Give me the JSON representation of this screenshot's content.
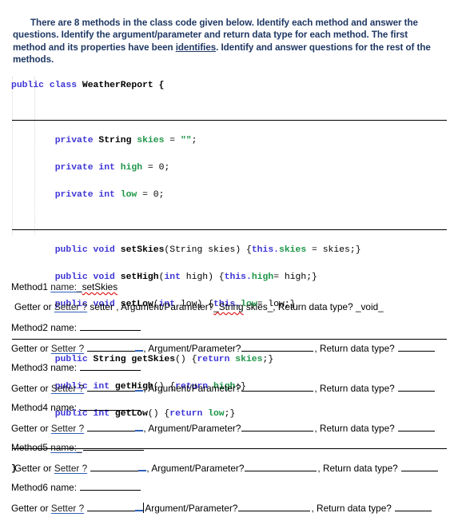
{
  "document": {
    "intro": {
      "part1": "There are 8 methods in the class code given below. Identify each method and answer the questions. Identify the argument/parameter and return data type for each method. The first method and its properties have been ",
      "underlined_word": "identifies",
      "part2": ". Identify and answer questions for the rest of the methods."
    },
    "code": {
      "language": "java",
      "class_name": "WeatherReport",
      "lines": [
        {
          "id": "line-class-decl",
          "text": "public class WeatherReport {"
        },
        {
          "id": "line-blank-1",
          "text": ""
        },
        {
          "id": "line-field-skies",
          "text": "        private String skies = \"\";"
        },
        {
          "id": "line-field-high",
          "text": "        private int high = 0;"
        },
        {
          "id": "line-field-low",
          "text": "        private int low = 0;"
        },
        {
          "id": "line-blank-2",
          "text": ""
        },
        {
          "id": "line-setSkies",
          "text": "        public void setSkies(String skies) {this.skies = skies;}"
        },
        {
          "id": "line-setHigh",
          "text": "        public void setHigh(int high) {this.high= high;}"
        },
        {
          "id": "line-setLow",
          "text": "        public void setLow(int low) {this.low= low;}"
        },
        {
          "id": "line-blank-3",
          "text": ""
        },
        {
          "id": "line-getSkies",
          "text": "        public String getSkies() {return skies;}"
        },
        {
          "id": "line-getHigh",
          "text": "        public int getHigh() {return high;}"
        },
        {
          "id": "line-getLow",
          "text": "        public int getLow() {return low;}"
        },
        {
          "id": "line-blank-4",
          "text": ""
        },
        {
          "id": "line-class-close",
          "text": "}"
        }
      ],
      "tokens": {
        "kw_public": "public",
        "kw_class": "class",
        "kw_private": "private",
        "kw_int": "int",
        "kw_void": "void",
        "kw_return": "return",
        "kw_this": "this",
        "type_string": "String",
        "field_skies": "skies",
        "field_high": "high",
        "field_low": "low",
        "literal_empty_string": "\"\"",
        "literal_zero": "0",
        "method_setSkies": "setSkies",
        "method_setHigh": "setHigh",
        "method_setLow": "setLow",
        "method_getSkies": "getSkies",
        "method_getHigh": "getHigh",
        "method_getLow": "getLow"
      },
      "colors": {
        "keyword": "#3E36D6",
        "identifier": "#000000",
        "field": "#1E9648",
        "string": "#1E9648"
      }
    },
    "worksheet": {
      "labels": {
        "getter_or": "Getter or ",
        "setter_q": "Setter ?",
        "arg_param": "Argument/Parameter?",
        "return_type": "Return data type?",
        "name_label": "name:",
        "comma": ", "
      },
      "methods": [
        {
          "id": "method-1",
          "number_label": "Method1",
          "name_label": "name:_",
          "name_value": "setSkies",
          "name_filled": true,
          "answer_kind": "setter ",
          "answer_param": "String skies_",
          "answer_return": "_void_",
          "answered": true
        },
        {
          "id": "method-2",
          "number_label": "Method2",
          "name_label": "name:",
          "name_value": "",
          "name_filled": false,
          "answer_kind": "",
          "answer_param": "",
          "answer_return": "",
          "answered": false
        },
        {
          "id": "method-3",
          "number_label": "Method3",
          "name_label": "name:",
          "name_value": "",
          "name_filled": false,
          "answer_kind": "",
          "answer_param": "",
          "answer_return": "",
          "answered": false
        },
        {
          "id": "method-4",
          "number_label": "Method4",
          "name_label": "name:",
          "name_value": "",
          "name_filled": false,
          "answer_kind": "",
          "answer_param": "",
          "answer_return": "",
          "answered": false
        },
        {
          "id": "method-5",
          "number_label": "Method5",
          "name_label": "name:_",
          "name_value": "",
          "name_filled": false,
          "answer_kind": "",
          "answer_param": "",
          "answer_return": "",
          "answered": false
        },
        {
          "id": "method-6",
          "number_label": "Method6",
          "name_label": "name:",
          "name_value": "",
          "name_filled": false,
          "answer_kind": "",
          "answer_param": "",
          "answer_return": "",
          "answered": false
        }
      ]
    },
    "colors": {
      "intro_text": "#1F3864",
      "body_text": "#000000",
      "spellcheck_underline": "#E02020",
      "grammar_underline": "#2E5FB8",
      "page_background": "#FFFFFF"
    }
  }
}
